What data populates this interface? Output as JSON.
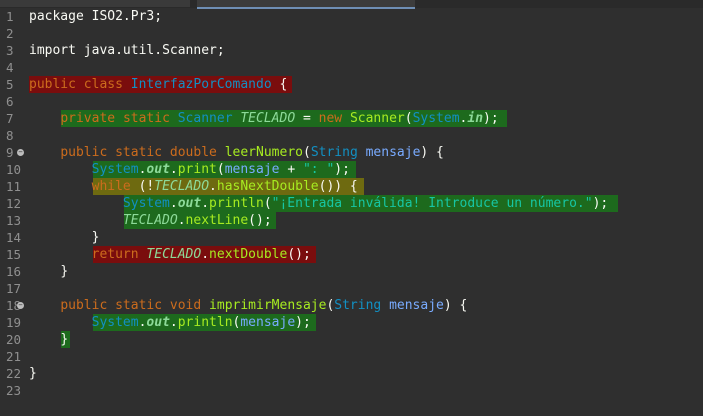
{
  "editor": {
    "lines": [
      {
        "n": "1",
        "tokens": [
          {
            "t": "package ",
            "c": "pl"
          },
          {
            "t": "ISO2.Pr3;",
            "c": "pl"
          }
        ]
      },
      {
        "n": "2",
        "tokens": []
      },
      {
        "n": "3",
        "tokens": [
          {
            "t": "import ",
            "c": "pl"
          },
          {
            "t": "java.util.Scanner;",
            "c": "pl"
          }
        ]
      },
      {
        "n": "4",
        "tokens": []
      },
      {
        "n": "5",
        "hl": "red",
        "indent": 0,
        "tokens": [
          {
            "t": "public ",
            "c": "kw"
          },
          {
            "t": "class ",
            "c": "kw"
          },
          {
            "t": "InterfazPorComando ",
            "c": "cls"
          },
          {
            "t": "{",
            "c": "pl"
          }
        ]
      },
      {
        "n": "6",
        "tokens": []
      },
      {
        "n": "7",
        "hl": "green",
        "indent": 4,
        "tokens": [
          {
            "t": "private ",
            "c": "kw"
          },
          {
            "t": "static ",
            "c": "kw"
          },
          {
            "t": "Scanner ",
            "c": "ty"
          },
          {
            "t": "TECLADO",
            "c": "cst"
          },
          {
            "t": " = ",
            "c": "pl"
          },
          {
            "t": "new ",
            "c": "kw"
          },
          {
            "t": "Scanner",
            "c": "mth"
          },
          {
            "t": "(",
            "c": "pl"
          },
          {
            "t": "System",
            "c": "ty"
          },
          {
            "t": ".",
            "c": "pl"
          },
          {
            "t": "in",
            "c": "sfld"
          },
          {
            "t": ");",
            "c": "pl"
          }
        ]
      },
      {
        "n": "8",
        "tokens": []
      },
      {
        "n": "9",
        "fold": true,
        "indent": 4,
        "tokens": [
          {
            "t": "public ",
            "c": "kw"
          },
          {
            "t": "static ",
            "c": "kw"
          },
          {
            "t": "double ",
            "c": "kw"
          },
          {
            "t": "leerNumero",
            "c": "mth"
          },
          {
            "t": "(",
            "c": "pl"
          },
          {
            "t": "String ",
            "c": "ty"
          },
          {
            "t": "mensaje",
            "c": "prm"
          },
          {
            "t": ") {",
            "c": "pl"
          }
        ]
      },
      {
        "n": "10",
        "hl": "green",
        "indent": 8,
        "tokens": [
          {
            "t": "System",
            "c": "ty"
          },
          {
            "t": ".",
            "c": "pl"
          },
          {
            "t": "out",
            "c": "sfld"
          },
          {
            "t": ".",
            "c": "pl"
          },
          {
            "t": "print",
            "c": "mth"
          },
          {
            "t": "(",
            "c": "pl"
          },
          {
            "t": "mensaje",
            "c": "prm"
          },
          {
            "t": " + ",
            "c": "pl"
          },
          {
            "t": "\": \"",
            "c": "str"
          },
          {
            "t": ");",
            "c": "pl"
          }
        ]
      },
      {
        "n": "11",
        "hl": "yellow",
        "indent": 8,
        "tokens": [
          {
            "t": "while ",
            "c": "kw"
          },
          {
            "t": "(!",
            "c": "pl"
          },
          {
            "t": "TECLADO",
            "c": "cst"
          },
          {
            "t": ".",
            "c": "pl"
          },
          {
            "t": "hasNextDouble",
            "c": "mth"
          },
          {
            "t": "()) {",
            "c": "pl"
          }
        ]
      },
      {
        "n": "12",
        "hl": "green",
        "indent": 12,
        "tokens": [
          {
            "t": "System",
            "c": "ty"
          },
          {
            "t": ".",
            "c": "pl"
          },
          {
            "t": "out",
            "c": "sfld"
          },
          {
            "t": ".",
            "c": "pl"
          },
          {
            "t": "println",
            "c": "mth"
          },
          {
            "t": "(",
            "c": "pl"
          },
          {
            "t": "\"¡Entrada inválida! Introduce un número.\"",
            "c": "str"
          },
          {
            "t": ");",
            "c": "pl"
          }
        ]
      },
      {
        "n": "13",
        "hl": "green",
        "indent": 12,
        "tokens": [
          {
            "t": "TECLADO",
            "c": "cst"
          },
          {
            "t": ".",
            "c": "pl"
          },
          {
            "t": "nextLine",
            "c": "mth"
          },
          {
            "t": "();",
            "c": "pl"
          }
        ]
      },
      {
        "n": "14",
        "indent": 8,
        "tokens": [
          {
            "t": "}",
            "c": "pl"
          }
        ]
      },
      {
        "n": "15",
        "hl": "red",
        "indent": 8,
        "tokens": [
          {
            "t": "return ",
            "c": "kw"
          },
          {
            "t": "TECLADO",
            "c": "cst"
          },
          {
            "t": ".",
            "c": "pl"
          },
          {
            "t": "nextDouble",
            "c": "mth"
          },
          {
            "t": "();",
            "c": "pl"
          }
        ]
      },
      {
        "n": "16",
        "indent": 4,
        "tokens": [
          {
            "t": "}",
            "c": "pl"
          }
        ]
      },
      {
        "n": "17",
        "tokens": []
      },
      {
        "n": "18",
        "fold": true,
        "indent": 4,
        "tokens": [
          {
            "t": "public ",
            "c": "kw"
          },
          {
            "t": "static ",
            "c": "kw"
          },
          {
            "t": "void ",
            "c": "kw"
          },
          {
            "t": "imprimirMensaje",
            "c": "mth"
          },
          {
            "t": "(",
            "c": "pl"
          },
          {
            "t": "String ",
            "c": "ty"
          },
          {
            "t": "mensaje",
            "c": "prm"
          },
          {
            "t": ") {",
            "c": "pl"
          }
        ]
      },
      {
        "n": "19",
        "hl": "green",
        "indent": 8,
        "tokens": [
          {
            "t": "System",
            "c": "ty"
          },
          {
            "t": ".",
            "c": "pl"
          },
          {
            "t": "out",
            "c": "sfld"
          },
          {
            "t": ".",
            "c": "pl"
          },
          {
            "t": "println",
            "c": "mth"
          },
          {
            "t": "(",
            "c": "pl"
          },
          {
            "t": "mensaje",
            "c": "prm"
          },
          {
            "t": ");",
            "c": "pl"
          }
        ]
      },
      {
        "n": "20",
        "hl": "green",
        "indent": 4,
        "tokens": [
          {
            "t": "}",
            "c": "pl"
          }
        ]
      },
      {
        "n": "21",
        "tokens": []
      },
      {
        "n": "22",
        "tokens": [
          {
            "t": "}",
            "c": "pl"
          }
        ]
      },
      {
        "n": "23",
        "tokens": []
      }
    ]
  }
}
